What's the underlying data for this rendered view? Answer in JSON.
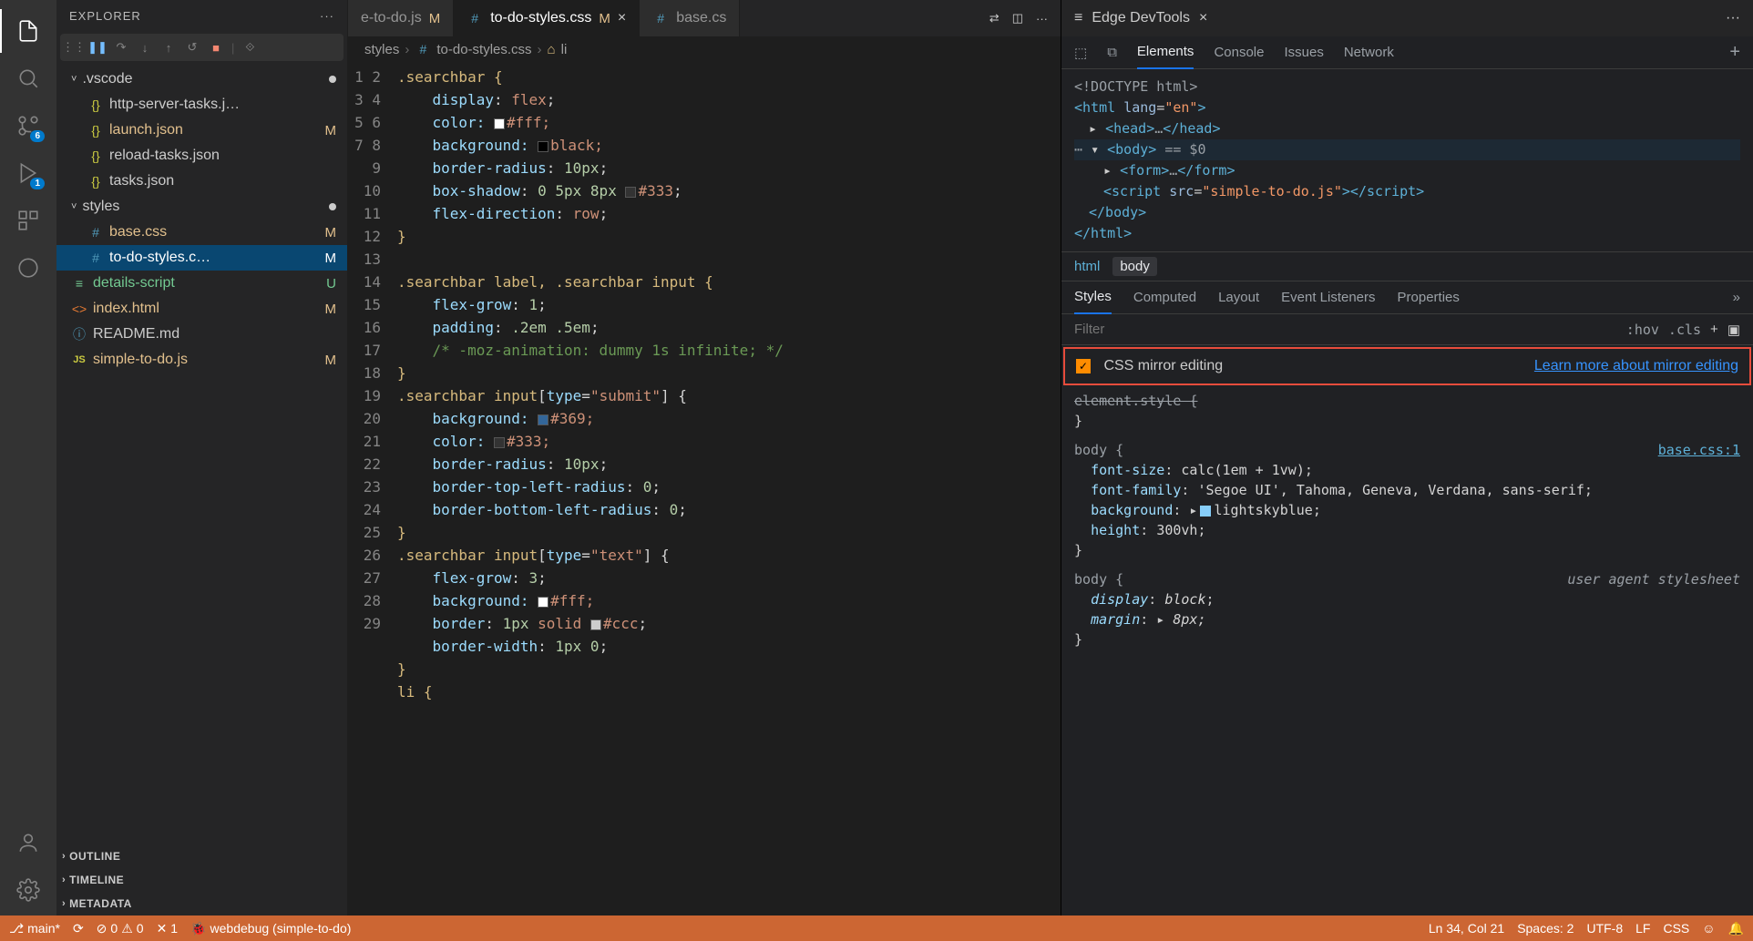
{
  "sidebar": {
    "title": "EXPLORER",
    "sections": {
      "vscode_folder": ".vscode",
      "styles_folder": "styles",
      "outline": "OUTLINE",
      "timeline": "TIMELINE",
      "metadata": "METADATA"
    },
    "files": {
      "http_server": "http-server-tasks.j…",
      "launch": "launch.json",
      "reload": "reload-tasks.json",
      "tasks": "tasks.json",
      "base_css": "base.css",
      "todo_css": "to-do-styles.c…",
      "details": "details-script",
      "index": "index.html",
      "readme": "README.md",
      "simple": "simple-to-do.js"
    },
    "badges": {
      "m": "M",
      "u": "U"
    }
  },
  "tabs": {
    "tab1": "e-to-do.js",
    "tab2": "to-do-styles.css",
    "tab3": "base.cs"
  },
  "breadcrumb": {
    "p1": "styles",
    "p2": "to-do-styles.css",
    "p3": "li"
  },
  "code": {
    "l1": ".searchbar {",
    "l2": "    display: flex;",
    "l3_a": "    color: ",
    "l3_b": "#fff;",
    "l4_a": "    background: ",
    "l4_b": "black;",
    "l5": "    border-radius: 10px;",
    "l6_a": "    box-shadow: 0 5px 8px ",
    "l6_b": "#333;",
    "l7": "    flex-direction: row;",
    "l8": "}",
    "l10": ".searchbar label, .searchbar input {",
    "l11": "    flex-grow: 1;",
    "l12": "    padding: .2em .5em;",
    "l13": "    /* -moz-animation: dummy 1s infinite; */",
    "l14": "}",
    "l15": ".searchbar input[type=\"submit\"] {",
    "l16_a": "    background: ",
    "l16_b": "#369;",
    "l17_a": "    color: ",
    "l17_b": "#333;",
    "l18": "    border-radius: 10px;",
    "l19": "    border-top-left-radius: 0;",
    "l20": "    border-bottom-left-radius: 0;",
    "l21": "}",
    "l22": ".searchbar input[type=\"text\"] {",
    "l23": "    flex-grow: 3;",
    "l24_a": "    background: ",
    "l24_b": "#fff;",
    "l25_a": "    border: 1px solid ",
    "l25_b": "#ccc;",
    "l26": "    border-width: 1px 0;",
    "l27": "}",
    "l28": "li {"
  },
  "devtools": {
    "title": "Edge DevTools",
    "tabs": {
      "elements": "Elements",
      "console": "Console",
      "issues": "Issues",
      "network": "Network"
    },
    "dom": {
      "doctype": "<!DOCTYPE html>",
      "html_open": "<html lang=\"en\">",
      "head": "<head>…</head>",
      "body_open": "<body>",
      "body_ann": " == $0",
      "form": "<form>…</form>",
      "script": "<script src=\"simple-to-do.js\"></script",
      "body_close": "</body>",
      "html_close": "</html>"
    },
    "crumb": {
      "html": "html",
      "body": "body"
    },
    "subtabs": {
      "styles": "Styles",
      "computed": "Computed",
      "layout": "Layout",
      "listeners": "Event Listeners",
      "properties": "Properties"
    },
    "filter_placeholder": "Filter",
    "hov": ":hov",
    "cls": ".cls",
    "mirror": {
      "label": "CSS mirror editing",
      "link": "Learn more about mirror editing"
    },
    "rules": {
      "elstyle": "element.style {",
      "body_sel": "body {",
      "base_origin": "base.css:1",
      "fs": "font-size: calc(1em + 1vw);",
      "ff": "font-family: 'Segoe UI', Tahoma, Geneva, Verdana, sans-serif;",
      "bg": "background: ",
      "bg_val": "lightskyblue;",
      "ht": "height: 300vh;",
      "ua": "user agent stylesheet",
      "disp": "display: block;",
      "marg": "margin: ",
      "marg_val": "8px;"
    }
  },
  "status": {
    "branch": "main*",
    "errors": "0",
    "warnings": "0",
    "tasks": "1",
    "debug": "webdebug (simple-to-do)",
    "cursor": "Ln 34, Col 21",
    "spaces": "Spaces: 2",
    "encoding": "UTF-8",
    "eol": "LF",
    "lang": "CSS"
  },
  "activity_badges": {
    "scm": "6",
    "debug": "1"
  }
}
